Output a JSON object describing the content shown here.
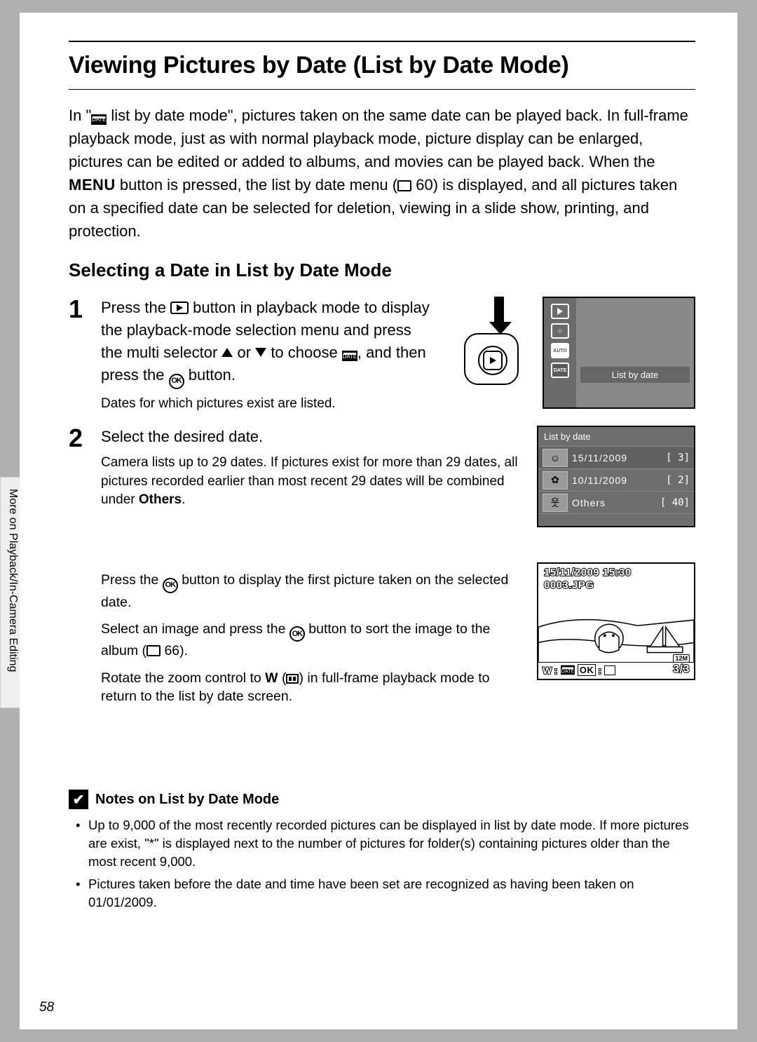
{
  "title": "Viewing Pictures by Date (List by Date Mode)",
  "intro_parts": {
    "p1": "In \"",
    "p2": " list by date mode\", pictures taken on the same date can be played back. In full-frame playback mode, just as with normal playback mode, picture display can be enlarged, pictures can be edited or added to albums, and movies can be played back. When the ",
    "menu": "MENU",
    "p3": " button is pressed, the list by date menu (",
    "ref": " 60) is displayed, and all pictures taken on a specified date can be selected for deletion, viewing in a slide show, printing, and protection."
  },
  "subtitle": "Selecting a Date in List by Date Mode",
  "step1": {
    "num": "1",
    "text_a": "Press the ",
    "text_b": " button in playback mode to display the playback-mode selection menu and press the multi selector ",
    "text_c": " or ",
    "text_d": " to choose ",
    "text_e": ", and then press the ",
    "text_f": " button.",
    "note": "Dates for which pictures exist are listed.",
    "ok": "OK",
    "date_glyph": "DATE"
  },
  "screen1": {
    "label": "List by date",
    "auto": "AUTO",
    "date": "DATE"
  },
  "step2": {
    "num": "2",
    "title": "Select the desired date.",
    "para1a": "Camera lists up to 29 dates. If pictures exist for more than 29 dates, all pictures recorded earlier than most recent 29 dates will be combined under ",
    "others_bold": "Others",
    "para1b": ".",
    "para2a": "Press the ",
    "ok": "OK",
    "para2b": " button to display the first picture taken on the selected date.",
    "para3a": "Select an image and press the ",
    "para3b": " button to sort the image to the album (",
    "para3_ref": " 66).",
    "para4a": "Rotate the zoom control to ",
    "w": "W",
    "para4b": " (",
    "para4c": ") in full-frame playback mode to return to the list by date screen."
  },
  "screen2": {
    "title": "List by date",
    "rows": [
      {
        "date": "15/11/2009",
        "count": "[    3]"
      },
      {
        "date": "10/11/2009",
        "count": "[    2]"
      },
      {
        "date": "Others",
        "count": "[  40]"
      }
    ]
  },
  "screen3": {
    "datetime": "15/11/2009 15:30",
    "file": "0003.JPG",
    "w": "W",
    "date": "DATE",
    "ok": "OK",
    "res": "12M",
    "counter_a": "3/",
    "counter_b": "3"
  },
  "notes": {
    "title": "Notes on List by Date Mode",
    "items": [
      "Up to 9,000 of the most recently recorded pictures can be displayed in list by date mode. If more pictures are exist, \"*\" is displayed next to the number of pictures for folder(s) containing pictures older than the most recent 9,000.",
      "Pictures taken before the date and time have been set are recognized as having been taken on 01/01/2009."
    ]
  },
  "sidetab": "More on Playback/In-Camera Editing",
  "page_num": "58"
}
